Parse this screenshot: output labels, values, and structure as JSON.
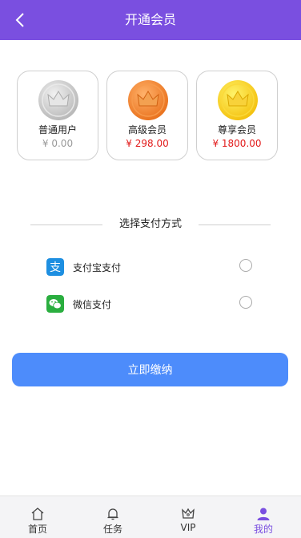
{
  "header": {
    "title": "开通会员",
    "back_icon": "chevron-left-icon",
    "color": "#7a4fe0"
  },
  "tiers": [
    {
      "name": "普通用户",
      "price": "¥ 0.00",
      "icon": "crown-coin-silver-icon",
      "price_color": "#999999"
    },
    {
      "name": "高级会员",
      "price": "¥ 298.00",
      "icon": "crown-coin-bronze-icon",
      "price_color": "#e21a1a"
    },
    {
      "name": "尊享会员",
      "price": "¥ 1800.00",
      "icon": "crown-coin-gold-icon",
      "price_color": "#e21a1a"
    }
  ],
  "payment": {
    "title": "选择支付方式",
    "options": [
      {
        "label": "支付宝支付",
        "icon": "alipay-icon",
        "color": "#1e8fe1"
      },
      {
        "label": "微信支付",
        "icon": "wechat-icon",
        "color": "#2aae3f"
      }
    ]
  },
  "submit": {
    "label": "立即缴纳",
    "color": "#4d8cfb"
  },
  "tabbar": {
    "items": [
      {
        "label": "首页",
        "icon": "home-icon"
      },
      {
        "label": "任务",
        "icon": "bell-icon"
      },
      {
        "label": "VIP",
        "icon": "crown-icon"
      },
      {
        "label": "我的",
        "icon": "user-icon",
        "active": true
      }
    ],
    "active_color": "#7a4fe0"
  }
}
